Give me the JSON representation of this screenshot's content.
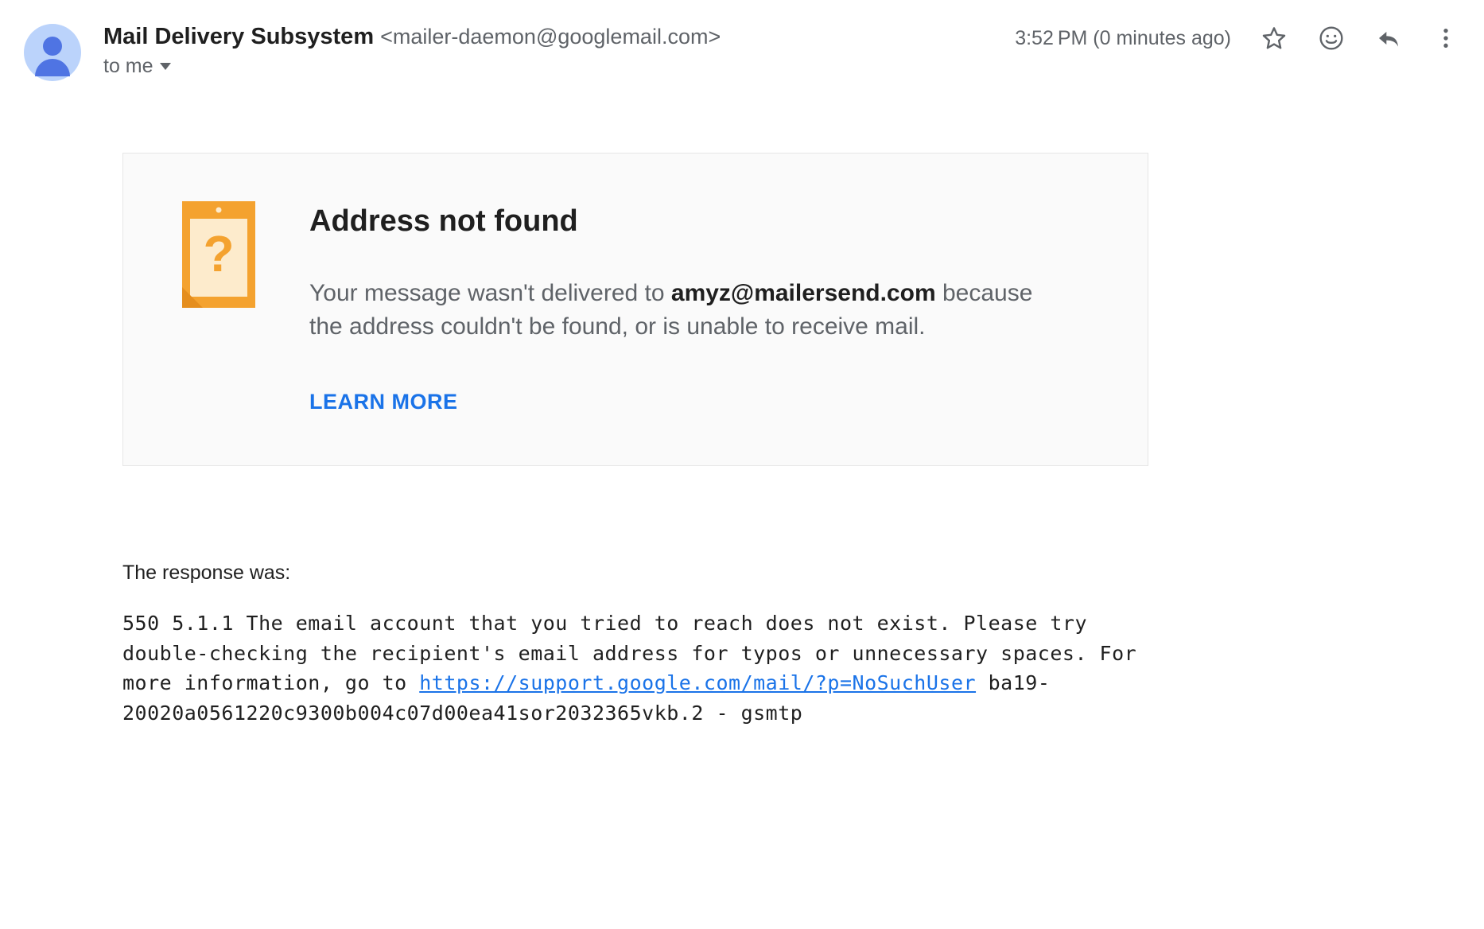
{
  "header": {
    "sender_name": "Mail Delivery Subsystem",
    "sender_email": "<mailer-daemon@googlemail.com>",
    "to_line": "to me",
    "timestamp": "3:52 PM (0 minutes ago)"
  },
  "card": {
    "title": "Address not found",
    "desc_before": "Your message wasn't delivered to ",
    "desc_address": "amyz@mailersend.com",
    "desc_after": " because the address couldn't be found, or is unable to receive mail.",
    "learn_more": "LEARN MORE"
  },
  "response": {
    "label": "The response was:",
    "text_before": "550 5.1.1 The email account that you tried to reach does not exist. Please try double-checking the recipient's email address for typos or unnecessary spaces. For more information, go to ",
    "link": "https://support.google.com/mail/?p=NoSuchUser",
    "text_after": " ba19-20020a0561220c9300b004c07d00ea41sor2032365vkb.2 - gsmtp"
  }
}
